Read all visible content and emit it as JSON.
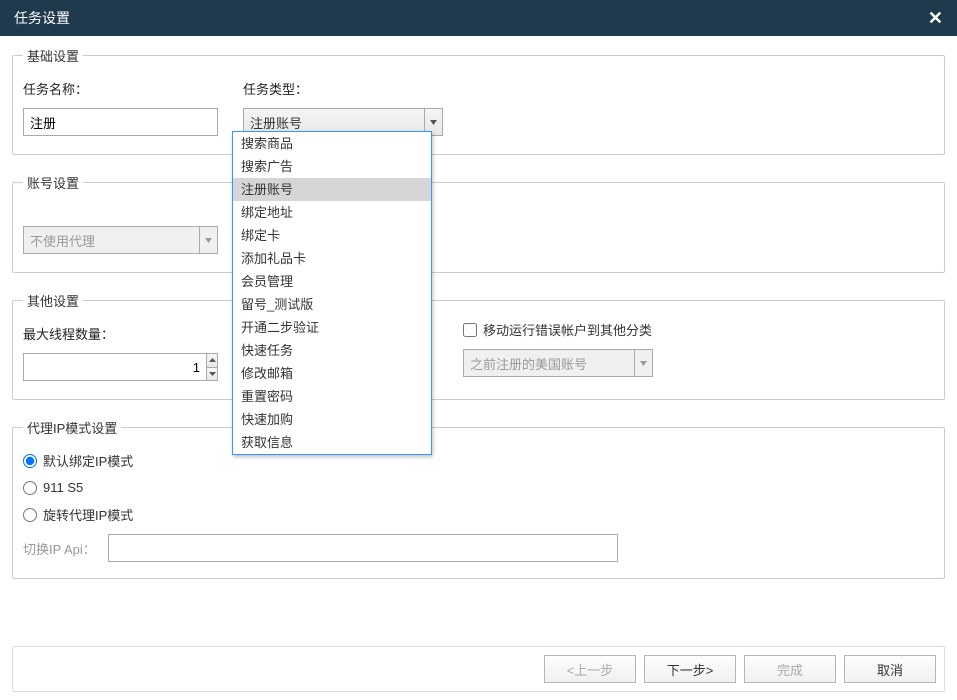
{
  "dialog": {
    "title": "任务设置"
  },
  "basic": {
    "legend": "基础设置",
    "name_label": "任务名称：",
    "name_value": "注册",
    "type_label": "任务类型：",
    "type_value": "注册账号",
    "type_options": [
      "搜索商品",
      "搜索广告",
      "注册账号",
      "绑定地址",
      "绑定卡",
      "添加礼品卡",
      "会员管理",
      "留号_测试版",
      "开通二步验证",
      "快速任务",
      "修改邮箱",
      "重置密码",
      "快速加购",
      "获取信息"
    ]
  },
  "account": {
    "legend": "账号设置",
    "proxy_value": "不使用代理"
  },
  "other": {
    "legend": "其他设置",
    "max_threads_label": "最大线程数量：",
    "max_threads_value": "1",
    "move_error_label": "移动运行错误帐户到其他分类",
    "register_value": "之前注册的美国账号"
  },
  "proxy_ip": {
    "legend": "代理IP模式设置",
    "default_label": "默认绑定IP模式",
    "s5_label": "911 S5",
    "rotate_label": "旋转代理IP模式",
    "api_label": "切换IP Api："
  },
  "footer": {
    "prev": "<上一步",
    "next": "下一步>",
    "finish": "完成",
    "cancel": "取消"
  }
}
